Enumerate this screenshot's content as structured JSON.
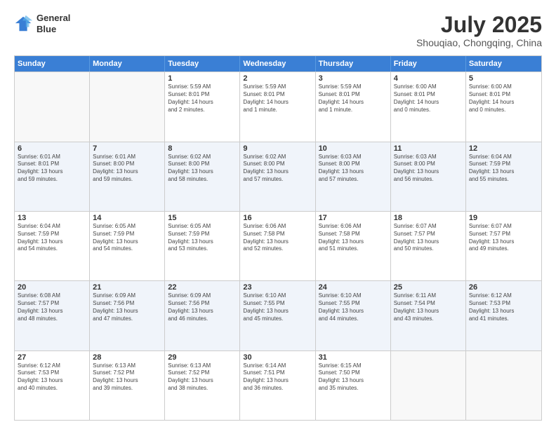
{
  "logo": {
    "line1": "General",
    "line2": "Blue"
  },
  "title": "July 2025",
  "subtitle": "Shouqiao, Chongqing, China",
  "header": {
    "days": [
      "Sunday",
      "Monday",
      "Tuesday",
      "Wednesday",
      "Thursday",
      "Friday",
      "Saturday"
    ]
  },
  "weeks": [
    [
      {
        "day": "",
        "info": ""
      },
      {
        "day": "",
        "info": ""
      },
      {
        "day": "1",
        "info": "Sunrise: 5:59 AM\nSunset: 8:01 PM\nDaylight: 14 hours\nand 2 minutes."
      },
      {
        "day": "2",
        "info": "Sunrise: 5:59 AM\nSunset: 8:01 PM\nDaylight: 14 hours\nand 1 minute."
      },
      {
        "day": "3",
        "info": "Sunrise: 5:59 AM\nSunset: 8:01 PM\nDaylight: 14 hours\nand 1 minute."
      },
      {
        "day": "4",
        "info": "Sunrise: 6:00 AM\nSunset: 8:01 PM\nDaylight: 14 hours\nand 0 minutes."
      },
      {
        "day": "5",
        "info": "Sunrise: 6:00 AM\nSunset: 8:01 PM\nDaylight: 14 hours\nand 0 minutes."
      }
    ],
    [
      {
        "day": "6",
        "info": "Sunrise: 6:01 AM\nSunset: 8:01 PM\nDaylight: 13 hours\nand 59 minutes."
      },
      {
        "day": "7",
        "info": "Sunrise: 6:01 AM\nSunset: 8:00 PM\nDaylight: 13 hours\nand 59 minutes."
      },
      {
        "day": "8",
        "info": "Sunrise: 6:02 AM\nSunset: 8:00 PM\nDaylight: 13 hours\nand 58 minutes."
      },
      {
        "day": "9",
        "info": "Sunrise: 6:02 AM\nSunset: 8:00 PM\nDaylight: 13 hours\nand 57 minutes."
      },
      {
        "day": "10",
        "info": "Sunrise: 6:03 AM\nSunset: 8:00 PM\nDaylight: 13 hours\nand 57 minutes."
      },
      {
        "day": "11",
        "info": "Sunrise: 6:03 AM\nSunset: 8:00 PM\nDaylight: 13 hours\nand 56 minutes."
      },
      {
        "day": "12",
        "info": "Sunrise: 6:04 AM\nSunset: 7:59 PM\nDaylight: 13 hours\nand 55 minutes."
      }
    ],
    [
      {
        "day": "13",
        "info": "Sunrise: 6:04 AM\nSunset: 7:59 PM\nDaylight: 13 hours\nand 54 minutes."
      },
      {
        "day": "14",
        "info": "Sunrise: 6:05 AM\nSunset: 7:59 PM\nDaylight: 13 hours\nand 54 minutes."
      },
      {
        "day": "15",
        "info": "Sunrise: 6:05 AM\nSunset: 7:59 PM\nDaylight: 13 hours\nand 53 minutes."
      },
      {
        "day": "16",
        "info": "Sunrise: 6:06 AM\nSunset: 7:58 PM\nDaylight: 13 hours\nand 52 minutes."
      },
      {
        "day": "17",
        "info": "Sunrise: 6:06 AM\nSunset: 7:58 PM\nDaylight: 13 hours\nand 51 minutes."
      },
      {
        "day": "18",
        "info": "Sunrise: 6:07 AM\nSunset: 7:57 PM\nDaylight: 13 hours\nand 50 minutes."
      },
      {
        "day": "19",
        "info": "Sunrise: 6:07 AM\nSunset: 7:57 PM\nDaylight: 13 hours\nand 49 minutes."
      }
    ],
    [
      {
        "day": "20",
        "info": "Sunrise: 6:08 AM\nSunset: 7:57 PM\nDaylight: 13 hours\nand 48 minutes."
      },
      {
        "day": "21",
        "info": "Sunrise: 6:09 AM\nSunset: 7:56 PM\nDaylight: 13 hours\nand 47 minutes."
      },
      {
        "day": "22",
        "info": "Sunrise: 6:09 AM\nSunset: 7:56 PM\nDaylight: 13 hours\nand 46 minutes."
      },
      {
        "day": "23",
        "info": "Sunrise: 6:10 AM\nSunset: 7:55 PM\nDaylight: 13 hours\nand 45 minutes."
      },
      {
        "day": "24",
        "info": "Sunrise: 6:10 AM\nSunset: 7:55 PM\nDaylight: 13 hours\nand 44 minutes."
      },
      {
        "day": "25",
        "info": "Sunrise: 6:11 AM\nSunset: 7:54 PM\nDaylight: 13 hours\nand 43 minutes."
      },
      {
        "day": "26",
        "info": "Sunrise: 6:12 AM\nSunset: 7:53 PM\nDaylight: 13 hours\nand 41 minutes."
      }
    ],
    [
      {
        "day": "27",
        "info": "Sunrise: 6:12 AM\nSunset: 7:53 PM\nDaylight: 13 hours\nand 40 minutes."
      },
      {
        "day": "28",
        "info": "Sunrise: 6:13 AM\nSunset: 7:52 PM\nDaylight: 13 hours\nand 39 minutes."
      },
      {
        "day": "29",
        "info": "Sunrise: 6:13 AM\nSunset: 7:52 PM\nDaylight: 13 hours\nand 38 minutes."
      },
      {
        "day": "30",
        "info": "Sunrise: 6:14 AM\nSunset: 7:51 PM\nDaylight: 13 hours\nand 36 minutes."
      },
      {
        "day": "31",
        "info": "Sunrise: 6:15 AM\nSunset: 7:50 PM\nDaylight: 13 hours\nand 35 minutes."
      },
      {
        "day": "",
        "info": ""
      },
      {
        "day": "",
        "info": ""
      }
    ]
  ]
}
